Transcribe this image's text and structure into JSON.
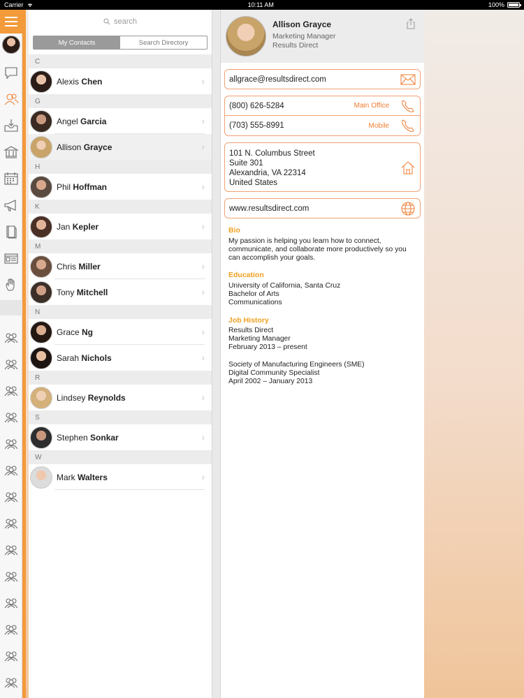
{
  "status_bar": {
    "carrier": "Carrier",
    "time": "10:11 AM",
    "battery": "100%"
  },
  "search": {
    "placeholder": "search"
  },
  "segments": {
    "my_contacts": "My Contacts",
    "search_directory": "Search Directory"
  },
  "sections": [
    {
      "letter": "C",
      "contacts": [
        {
          "first": "Alexis",
          "last": "Chen"
        }
      ]
    },
    {
      "letter": "G",
      "contacts": [
        {
          "first": "Angel",
          "last": "Garcia"
        },
        {
          "first": "Allison",
          "last": "Grayce",
          "selected": true
        }
      ]
    },
    {
      "letter": "H",
      "contacts": [
        {
          "first": "Phil",
          "last": "Hoffman"
        }
      ]
    },
    {
      "letter": "K",
      "contacts": [
        {
          "first": "Jan",
          "last": "Kepler"
        }
      ]
    },
    {
      "letter": "M",
      "contacts": [
        {
          "first": "Chris",
          "last": "Miller"
        },
        {
          "first": "Tony",
          "last": "Mitchell"
        }
      ]
    },
    {
      "letter": "N",
      "contacts": [
        {
          "first": "Grace",
          "last": "Ng"
        },
        {
          "first": "Sarah",
          "last": "Nichols"
        }
      ]
    },
    {
      "letter": "R",
      "contacts": [
        {
          "first": "Lindsey",
          "last": "Reynolds"
        }
      ]
    },
    {
      "letter": "S",
      "contacts": [
        {
          "first": "Stephen",
          "last": "Sonkar"
        }
      ]
    },
    {
      "letter": "W",
      "contacts": [
        {
          "first": "Mark",
          "last": "Walters"
        }
      ]
    }
  ],
  "detail": {
    "name": "Allison Grayce",
    "title": "Marketing Manager",
    "company": "Results Direct",
    "email": "allgrace@resultsdirect.com",
    "phones": [
      {
        "number": "(800) 626-5284",
        "label": "Main Office"
      },
      {
        "number": "(703) 555-8991",
        "label": "Mobile"
      }
    ],
    "address": {
      "line1": "101 N. Columbus Street",
      "line2": "Suite 301",
      "line3": "Alexandria, VA 22314",
      "line4": "United States"
    },
    "website": "www.resultsdirect.com",
    "bio_title": "Bio",
    "bio": "My passion is helping you learn how to connect, communicate, and collaborate more productively so you can accomplish your goals.",
    "education_title": "Education",
    "education": {
      "school": "University of California, Santa Cruz",
      "degree": "Bachelor of Arts",
      "field": "Communications"
    },
    "job_title": "Job History",
    "jobs": [
      {
        "company": "Results Direct",
        "role": "Marketing Manager",
        "dates": "February 2013 – present"
      },
      {
        "company": "Society of Manufacturing Engineers (SME)",
        "role": "Digital Community Specialist",
        "dates": "April 2002 – January 2013"
      }
    ]
  },
  "colors": {
    "accent": "#f39a3a",
    "section_title": "#f0a020",
    "card_border": "#f1a072"
  }
}
